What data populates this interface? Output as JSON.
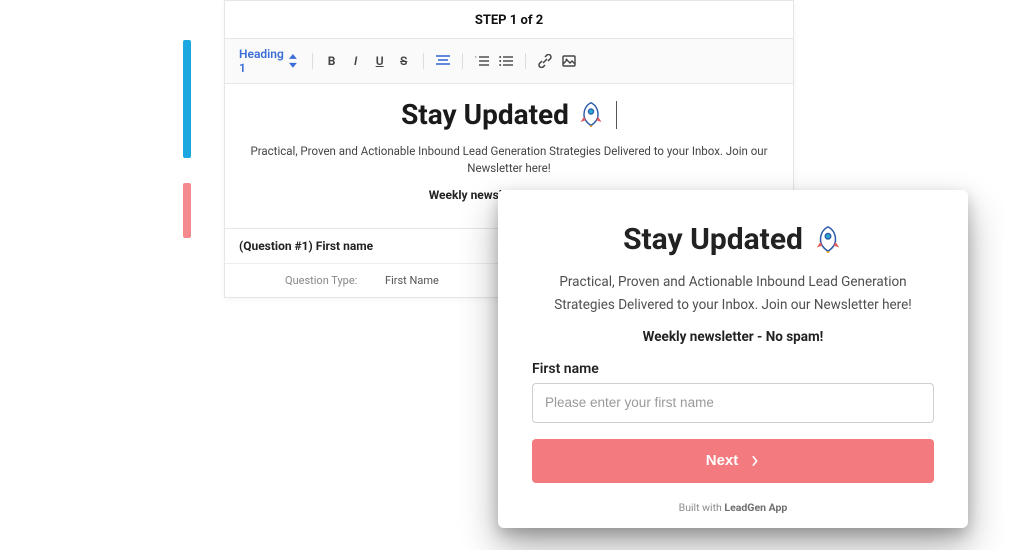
{
  "editor": {
    "step_header": "STEP 1 of 2",
    "heading_selector": "Heading 1",
    "title": "Stay Updated",
    "subtitle": "Practical, Proven and Actionable Inbound Lead Generation Strategies Delivered to your Inbox. Join our Newsletter here!",
    "bold_line": "Weekly newsletter - No spam!",
    "question": {
      "header": "(Question #1) First name",
      "type_label": "Question Type:",
      "type_value": "First Name"
    }
  },
  "form": {
    "title": "Stay Updated",
    "subtitle": "Practical, Proven and Actionable Inbound Lead Generation Strategies Delivered to your Inbox. Join our Newsletter here!",
    "bold_line": "Weekly newsletter - No spam!",
    "field_label": "First name",
    "placeholder": "Please enter your first name",
    "next_label": "Next",
    "built_with_prefix": "Built with ",
    "built_with_brand": "LeadGen App"
  },
  "colors": {
    "accent_blue": "#1ba8e0",
    "accent_pink": "#f37a7e"
  }
}
